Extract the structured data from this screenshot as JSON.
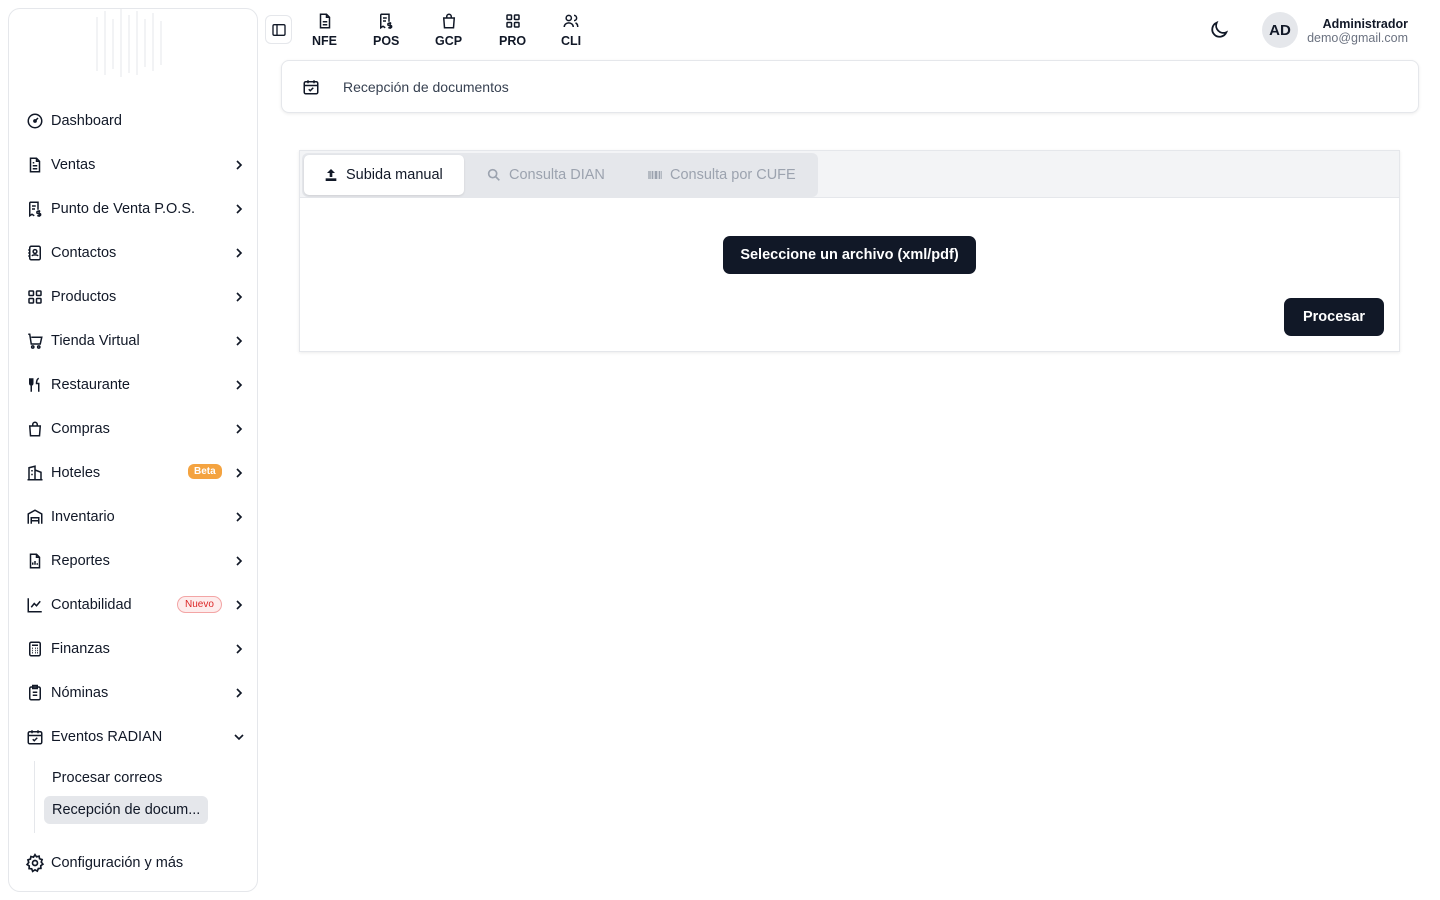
{
  "topnav": {
    "modules": [
      {
        "label": "NFE",
        "icon": "document-icon"
      },
      {
        "label": "POS",
        "icon": "receipt-dollar-icon"
      },
      {
        "label": "GCP",
        "icon": "shopping-bag-icon"
      },
      {
        "label": "PRO",
        "icon": "grid-icon"
      },
      {
        "label": "CLI",
        "icon": "users-icon"
      }
    ],
    "user": {
      "initials": "AD",
      "name": "Administrador",
      "email": "demo@gmail.com"
    }
  },
  "sidebar": {
    "items": [
      {
        "label": "Dashboard",
        "icon": "gauge-icon"
      },
      {
        "label": "Ventas",
        "icon": "file-text-icon"
      },
      {
        "label": "Punto de Venta P.O.S.",
        "icon": "receipt-dollar-icon"
      },
      {
        "label": "Contactos",
        "icon": "contact-book-icon"
      },
      {
        "label": "Productos",
        "icon": "grid-icon"
      },
      {
        "label": "Tienda Virtual",
        "icon": "cart-icon"
      },
      {
        "label": "Restaurante",
        "icon": "utensils-icon"
      },
      {
        "label": "Compras",
        "icon": "shopping-bag-icon"
      },
      {
        "label": "Hoteles",
        "icon": "building-icon",
        "badge": "Beta"
      },
      {
        "label": "Inventario",
        "icon": "warehouse-icon"
      },
      {
        "label": "Reportes",
        "icon": "report-icon"
      },
      {
        "label": "Contabilidad",
        "icon": "chart-icon",
        "badge": "Nuevo"
      },
      {
        "label": "Finanzas",
        "icon": "calculator-icon"
      },
      {
        "label": "Nóminas",
        "icon": "clipboard-icon"
      },
      {
        "label": "Eventos RADIAN",
        "icon": "calendar-check-icon"
      }
    ],
    "subitems": [
      "Procesar correos",
      "Recepción de docum..."
    ],
    "settings_label": "Configuración y más"
  },
  "breadcrumb": {
    "label": "Recepción de documentos"
  },
  "tabs": {
    "manual": "Subida manual",
    "dian": "Consulta DIAN",
    "cufe": "Consulta por CUFE"
  },
  "upload": {
    "select_label": "Seleccione un archivo (xml/pdf)",
    "process_label": "Procesar"
  },
  "colors": {
    "primary": "#111827",
    "beta": "#f4a340",
    "new": "#dc2626",
    "muted": "#9ca3af"
  }
}
